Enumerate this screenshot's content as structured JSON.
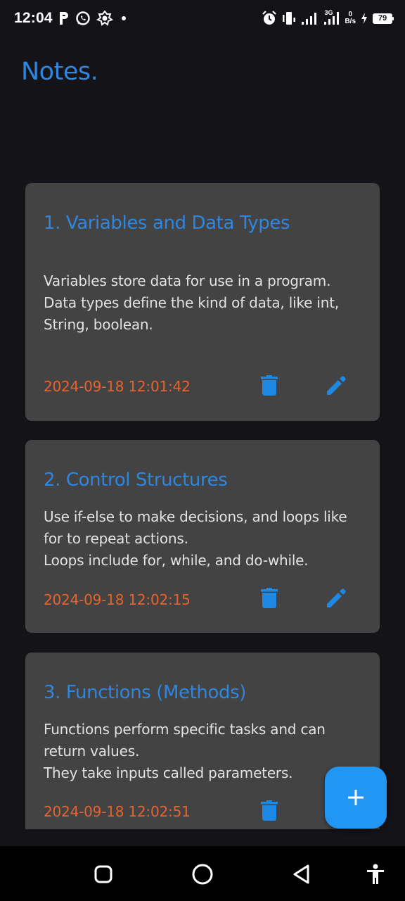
{
  "status_bar": {
    "time": "12:04",
    "network_type": "3G",
    "net_speed_value": "0",
    "net_speed_unit": "B/s",
    "battery_level": "79",
    "icons": [
      "parking-icon",
      "whatsapp-icon",
      "app-notification-icon",
      "dot-icon",
      "alarm-icon",
      "vibrate-icon",
      "signal-icon",
      "signal-3g-icon",
      "charging-icon",
      "battery-icon"
    ]
  },
  "app": {
    "title": "Notes."
  },
  "notes": [
    {
      "title": "1. Variables and Data Types",
      "body": "Variables store data for use in a program.\nData types define the kind of data, like int, String, boolean.",
      "date": "2024-09-18 12:01:42"
    },
    {
      "title": "2. Control Structures",
      "body": "Use if-else to make decisions, and loops like for to repeat actions.\nLoops include for, while, and do-while.",
      "date": "2024-09-18 12:02:15"
    },
    {
      "title": "3. Functions (Methods)",
      "body": "Functions perform specific tasks and can return values.\nThey take inputs called parameters.",
      "date": "2024-09-18 12:02:51"
    }
  ],
  "fab": {
    "icon": "plus-icon"
  },
  "nav_bar": {
    "icons": [
      "recent-apps-icon",
      "home-icon",
      "back-icon",
      "accessibility-icon"
    ]
  },
  "colors": {
    "background": "#141317",
    "card": "#434343",
    "accent": "#2e86de",
    "date": "#e8622c",
    "fab": "#2196f3",
    "icon": "#1e88e5"
  }
}
